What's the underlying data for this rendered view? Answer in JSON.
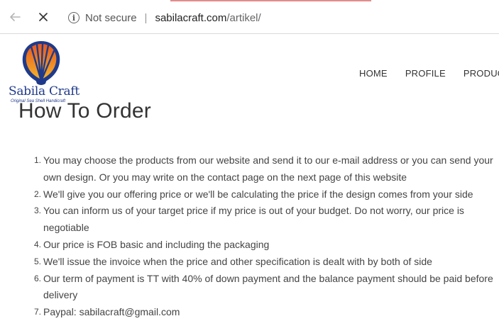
{
  "browser": {
    "security_label": "Not secure",
    "separator": "|",
    "url_host": "sabilacraft.com",
    "url_path": "/artikel/",
    "info_icon_glyph": "i",
    "accent_color": "#e38b8b"
  },
  "site": {
    "logo": {
      "name": "Sabila Craft",
      "tagline": "Original Sea Shell Handicraft",
      "colors": {
        "shell_outer": "#1f3a8a",
        "shell_top": "#e8581f",
        "shell_bottom": "#f4b32a",
        "text": "#1f3a8a"
      }
    },
    "nav": [
      {
        "label": "HOME"
      },
      {
        "label": "PROFILE"
      },
      {
        "label": "PRODUCT"
      }
    ]
  },
  "content": {
    "title": "How To Order",
    "steps": [
      {
        "num": "1.",
        "text": "You may choose the products from our website and send it to our e-mail address or you can send your own design. Or you may write on the contact page on the next page of this website"
      },
      {
        "num": "2.",
        "text": "We'll give you our offering price or we'll be calculating the price if the design comes from your side"
      },
      {
        "num": "3.",
        "text": "You can inform us of your target price if my price is out of your budget. Do not worry, our price is negotiable"
      },
      {
        "num": "4.",
        "text": "Our price is FOB basic and including the packaging"
      },
      {
        "num": "5.",
        "text": "We'll issue the invoice when the price and other specification is dealt with by both of side"
      },
      {
        "num": "6.",
        "text": "Our term of payment is TT with 40% of down payment and the balance payment should be paid before delivery"
      },
      {
        "num": "7.",
        "text": "Paypal: sabilacraft@gmail.com"
      }
    ]
  }
}
